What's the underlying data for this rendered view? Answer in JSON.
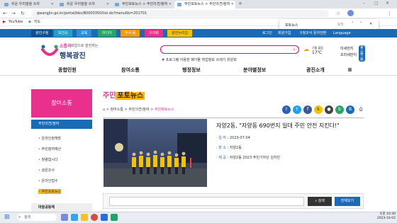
{
  "browser": {
    "tabs": [
      {
        "label": "쉬운 우리말을 쓰자"
      },
      {
        "label": "쉬운 우리말을 쓰자"
      },
      {
        "label": "주민포토뉴스 > 주민의견/참여"
      },
      {
        "label": "주민포토뉴스 > 주민의견/참여"
      }
    ],
    "url": "gwangjin.go.kr/portal/bbs/B0000350/list.do?menuNo=201701",
    "bookmarks": [
      "YouTube",
      "지도"
    ],
    "find": {
      "query": "포토뉴스",
      "count": "2/3"
    }
  },
  "site": {
    "topnav": [
      "광진구청",
      "보건소",
      "교육",
      "미디어",
      "부서·동",
      "구의회",
      "광진누리집"
    ],
    "topnav_colors": [
      "#1a6bb5",
      "#22a0c8",
      "#2f8fd6",
      "#29a36a",
      "#f39a12",
      "#e8308c",
      "#f5c200"
    ],
    "util": [
      "로그인",
      "회원가입",
      "구청조식 문자전환",
      "Language"
    ],
    "logo_lines": [
      "소통과 ",
      "행복광진"
    ],
    "logo_slogan": "화합으로 발전하는",
    "search_tags": [
      "# 프로그램",
      "이용판",
      "폐가물",
      "취업정보",
      "쓰레기",
      "위원회"
    ],
    "weather": {
      "temp": "17℃",
      "label": "구름 많음",
      "dust1": "미세먼지",
      "dust2": "초미세먼지",
      "grade": "좋음"
    },
    "mainmenu": [
      "종합민원",
      "참여소통",
      "행정정보",
      "분야별정보",
      "광진소개"
    ]
  },
  "sidebar": {
    "title": "참여소통",
    "sub": "주민의견/참여",
    "items": [
      "온라인정책방",
      "주민참여예산",
      "청렴합시다",
      "설문조사",
      "온라인접수",
      "주민포토뉴스"
    ],
    "footer": "마을공동체"
  },
  "content": {
    "title_a": "주민",
    "title_b": "포토뉴스",
    "crumbs": [
      "참여소통",
      "주민의견/참여",
      "주민포토뉴스"
    ],
    "article_title": "자양2동, \"자양동 690번지 일대 주민 안전 지킨다!\"",
    "meta": [
      {
        "key": "일 자",
        "value": "2023-07-04"
      },
      {
        "key": "장 소",
        "value": "자양2동"
      },
      {
        "key": "제 공",
        "value": "자양2동 2023 주민기자단 김지민"
      }
    ],
    "search_label": "검색",
    "all_label": "전체보기"
  },
  "taskbar": {
    "search": "검색",
    "time": "오후 10:30",
    "date": "2023-10-02"
  },
  "colors": {
    "brand": "#1a6bb5",
    "accent": "#e8308c",
    "highlight": "#ffb400"
  }
}
